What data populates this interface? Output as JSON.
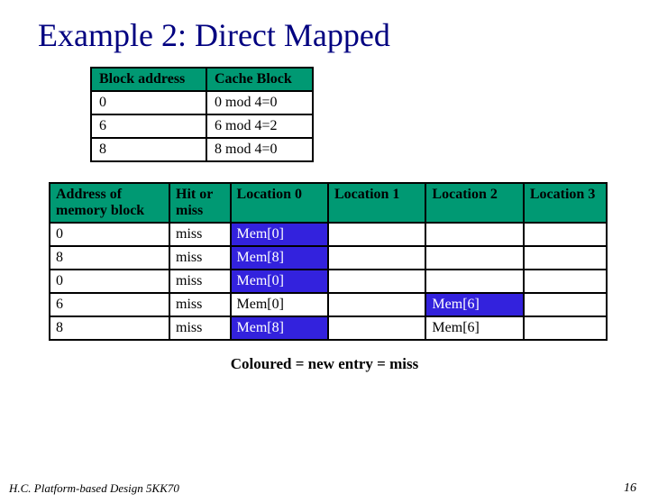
{
  "title": "Example 2:    Direct Mapped",
  "table1": {
    "headers": [
      "Block address",
      "Cache Block"
    ],
    "rows": [
      [
        "0",
        "0 mod 4=0"
      ],
      [
        "6",
        "6 mod 4=2"
      ],
      [
        "8",
        "8 mod 4=0"
      ]
    ]
  },
  "table2": {
    "headers": [
      "Address of memory block",
      "Hit or miss",
      "Location 0",
      "Location 1",
      "Location 2",
      "Location 3"
    ],
    "rows": [
      {
        "cells": [
          "0",
          "miss",
          "Mem[0]",
          "",
          "",
          ""
        ],
        "hl": [
          2
        ]
      },
      {
        "cells": [
          "8",
          "miss",
          "Mem[8]",
          "",
          "",
          ""
        ],
        "hl": [
          2
        ]
      },
      {
        "cells": [
          "0",
          "miss",
          "Mem[0]",
          "",
          "",
          ""
        ],
        "hl": [
          2
        ]
      },
      {
        "cells": [
          "6",
          "miss",
          "Mem[0]",
          "",
          "Mem[6]",
          ""
        ],
        "hl": [
          4
        ]
      },
      {
        "cells": [
          "8",
          "miss",
          "Mem[8]",
          "",
          "Mem[6]",
          ""
        ],
        "hl": [
          2
        ]
      }
    ]
  },
  "caption": "Coloured = new entry = miss",
  "footer_left": "H.C.   Platform-based Design  5KK70",
  "footer_right": "16"
}
